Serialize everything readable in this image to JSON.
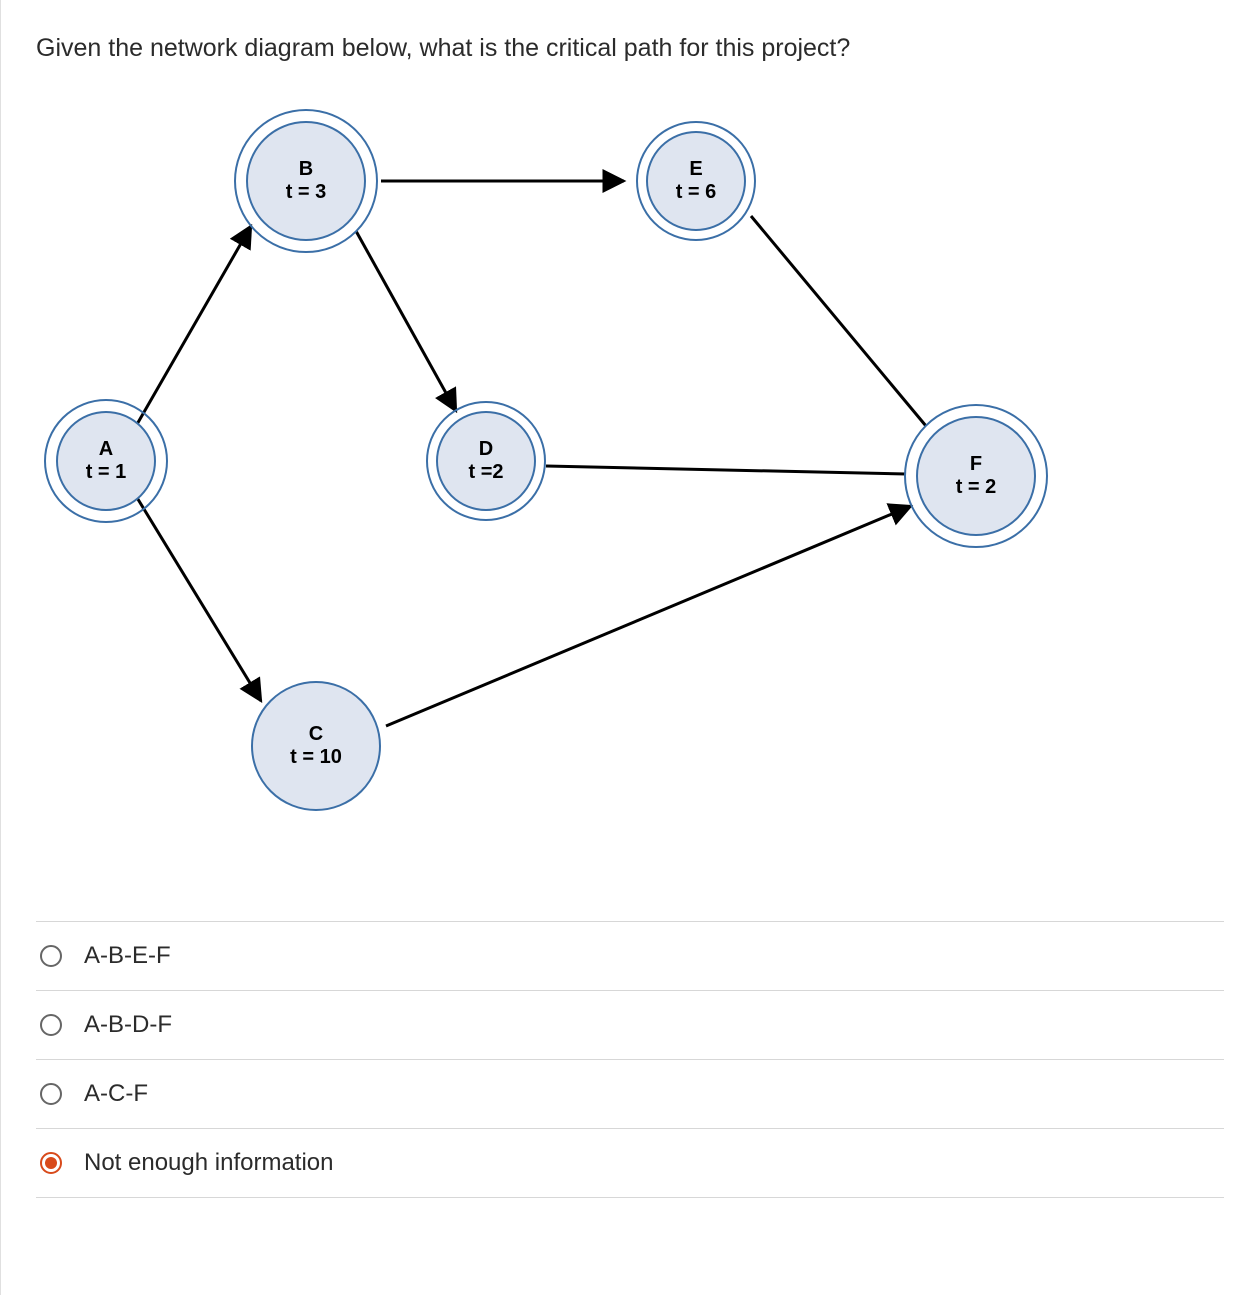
{
  "question": "Given the network diagram below, what is the critical path for this project?",
  "nodes": {
    "A": {
      "label": "A",
      "t": "t = 1"
    },
    "B": {
      "label": "B",
      "t": "t = 3"
    },
    "C": {
      "label": "C",
      "t": "t = 10"
    },
    "D": {
      "label": "D",
      "t": "t =2"
    },
    "E": {
      "label": "E",
      "t": "t = 6"
    },
    "F": {
      "label": "F",
      "t": "t = 2"
    }
  },
  "chart_data": {
    "type": "network",
    "nodes": [
      {
        "id": "A",
        "t": 1
      },
      {
        "id": "B",
        "t": 3
      },
      {
        "id": "C",
        "t": 10
      },
      {
        "id": "D",
        "t": 2
      },
      {
        "id": "E",
        "t": 6
      },
      {
        "id": "F",
        "t": 2
      }
    ],
    "edges": [
      {
        "from": "A",
        "to": "B"
      },
      {
        "from": "A",
        "to": "C"
      },
      {
        "from": "B",
        "to": "E"
      },
      {
        "from": "B",
        "to": "D"
      },
      {
        "from": "D",
        "to": "F"
      },
      {
        "from": "E",
        "to": "F"
      },
      {
        "from": "C",
        "to": "F"
      }
    ]
  },
  "options": [
    {
      "label": "A-B-E-F",
      "selected": false
    },
    {
      "label": "A-B-D-F",
      "selected": false
    },
    {
      "label": "A-C-F",
      "selected": false
    },
    {
      "label": "Not enough information",
      "selected": true
    }
  ]
}
